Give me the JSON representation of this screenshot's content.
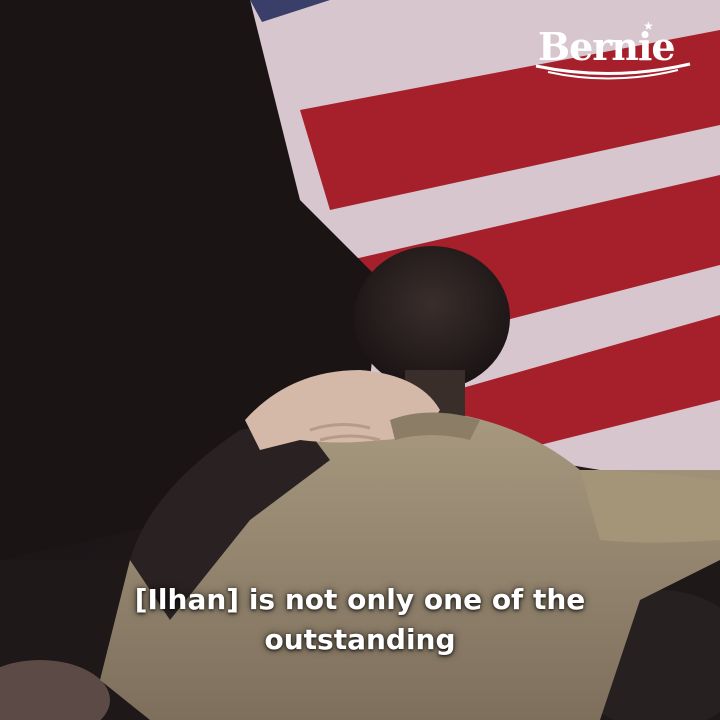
{
  "logo": {
    "text": "Bernie",
    "star": "★",
    "color": "#ffffff"
  },
  "caption": {
    "lines": [
      "[Ilhan] is not only one of the",
      "outstanding"
    ],
    "color": "#ffffff"
  },
  "colors": {
    "flag_red": "#a6202c",
    "flag_white": "#d8c6cf",
    "jacket": "#9a8a72",
    "background_dark": "#1e1718"
  }
}
